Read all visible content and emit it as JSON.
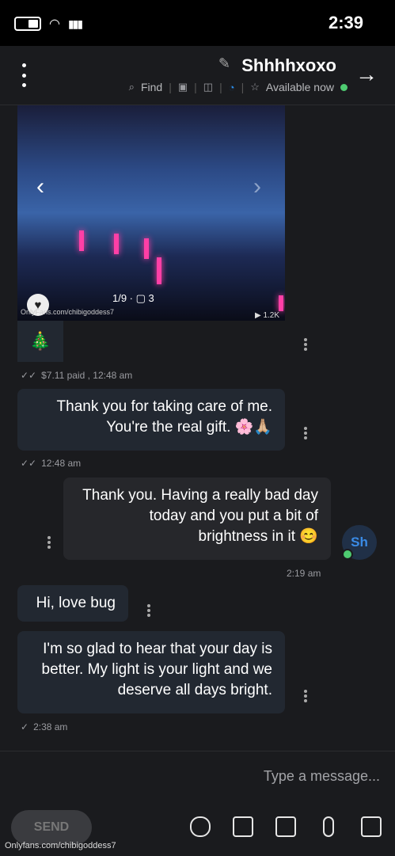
{
  "status": {
    "time": "2:39"
  },
  "header": {
    "name": "Shhhhxoxo",
    "availability": "Available now",
    "find": "Find"
  },
  "media": {
    "counter": "1/9 · ▢ 3",
    "credit": "OnlyFans.com/chibigoddess7",
    "views": "▶ 1.2K"
  },
  "messages": [
    {
      "id": "tree",
      "text": "🎄"
    },
    {
      "id": "meta1",
      "text": "$7.11 paid , 12:48 am"
    },
    {
      "id": "m1",
      "text": "Thank you for taking care of me. You're the real gift. 🌸🙏🏼"
    },
    {
      "id": "meta2",
      "text": "12:48 am"
    },
    {
      "id": "m2",
      "text": "Thank you. Having a really bad day today and you put a bit of brightness in it 😊"
    },
    {
      "id": "meta3",
      "text": "2:19 am"
    },
    {
      "id": "m3",
      "text": "Hi, love bug"
    },
    {
      "id": "m4",
      "text": "I'm so glad to hear that your day is better. My light is your light and we deserve all days bright."
    },
    {
      "id": "meta4",
      "text": "2:38 am"
    }
  ],
  "avatar": {
    "initials": "Sh"
  },
  "composer": {
    "placeholder": "Type a message...",
    "send_label": "SEND"
  },
  "watermark": "Onlyfans.com/chibigoddess7",
  "colors": {
    "accent": "#2b8ce8",
    "online": "#4ecb71"
  }
}
